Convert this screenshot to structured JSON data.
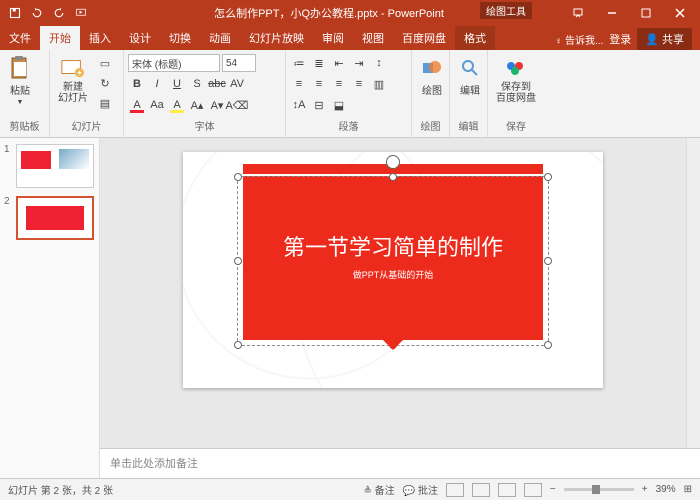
{
  "titlebar": {
    "filename": "怎么制作PPT，小Q办公教程.pptx - PowerPoint",
    "contextual_tools": "绘图工具"
  },
  "tabs": {
    "file": "文件",
    "home": "开始",
    "insert": "插入",
    "design": "设计",
    "transitions": "切换",
    "animations": "动画",
    "slideshow": "幻灯片放映",
    "review": "审阅",
    "view": "视图",
    "baidu": "百度网盘",
    "format": "格式",
    "tell_me": "告诉我...",
    "login": "登录",
    "share": "共享"
  },
  "ribbon": {
    "clipboard": {
      "paste": "粘贴",
      "label": "剪贴板"
    },
    "slides": {
      "new_slide": "新建\n幻灯片",
      "label": "幻灯片"
    },
    "font": {
      "name": "宋体 (标题)",
      "size": "54",
      "label": "字体"
    },
    "paragraph": {
      "label": "段落"
    },
    "drawing": {
      "label": "绘图",
      "btn": "绘图"
    },
    "editing": {
      "label": "编辑",
      "btn": "编辑"
    },
    "save": {
      "label": "保存",
      "btn": "保存到\n百度网盘"
    }
  },
  "slide": {
    "title": "第一节学习简单的制作",
    "subtitle": "做PPT从基础的开始"
  },
  "notes": {
    "placeholder": "单击此处添加备注"
  },
  "status": {
    "slide_info": "幻灯片 第 2 张，共 2 张",
    "notes": "备注",
    "comments": "批注",
    "zoom": "39%"
  },
  "thumbs": {
    "n1": "1",
    "n2": "2"
  }
}
